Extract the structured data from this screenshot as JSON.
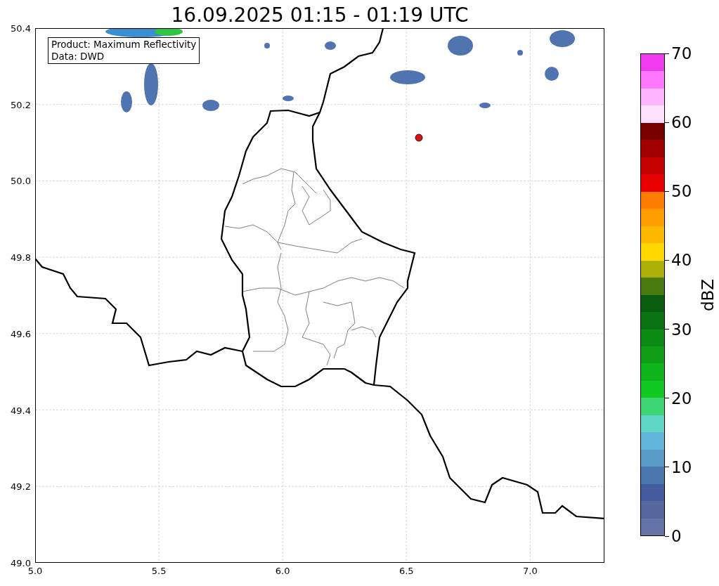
{
  "title": "16.09.2025 01:15 - 01:19 UTC",
  "map": {
    "info_box": [
      "Product: Maximum Reflectivity",
      "Data: DWD"
    ],
    "x_ticks": [
      "5.0",
      "5.5",
      "6.0",
      "6.5",
      "7.0"
    ],
    "y_ticks": [
      "50.4",
      "50.2",
      "50.0",
      "49.8",
      "49.6",
      "49.4",
      "49.2",
      "49.0"
    ]
  },
  "colorbar": {
    "label": "dBZ",
    "ticks": [
      "70",
      "60",
      "50",
      "40",
      "30",
      "20",
      "10",
      "0"
    ],
    "segments": [
      {
        "color": "#ee3cee"
      },
      {
        "color": "#ff78ff"
      },
      {
        "color": "#ffb4ff"
      },
      {
        "color": "#ffe0ff"
      },
      {
        "color": "#7a0000"
      },
      {
        "color": "#a00000"
      },
      {
        "color": "#c40000"
      },
      {
        "color": "#e60000"
      },
      {
        "color": "#ff7c00"
      },
      {
        "color": "#ff9c00"
      },
      {
        "color": "#ffb800"
      },
      {
        "color": "#ffd800"
      },
      {
        "color": "#aeb00a"
      },
      {
        "color": "#4a7a10"
      },
      {
        "color": "#0a5c10"
      },
      {
        "color": "#0a7212"
      },
      {
        "color": "#0b8a14"
      },
      {
        "color": "#0e9e18"
      },
      {
        "color": "#10b41c"
      },
      {
        "color": "#12c823"
      },
      {
        "color": "#3ed674"
      },
      {
        "color": "#60d6c6"
      },
      {
        "color": "#62b6dc"
      },
      {
        "color": "#5a9ac6"
      },
      {
        "color": "#4a78ae"
      },
      {
        "color": "#455c9e"
      },
      {
        "color": "#56679e"
      },
      {
        "color": "#6474a6"
      }
    ]
  }
}
